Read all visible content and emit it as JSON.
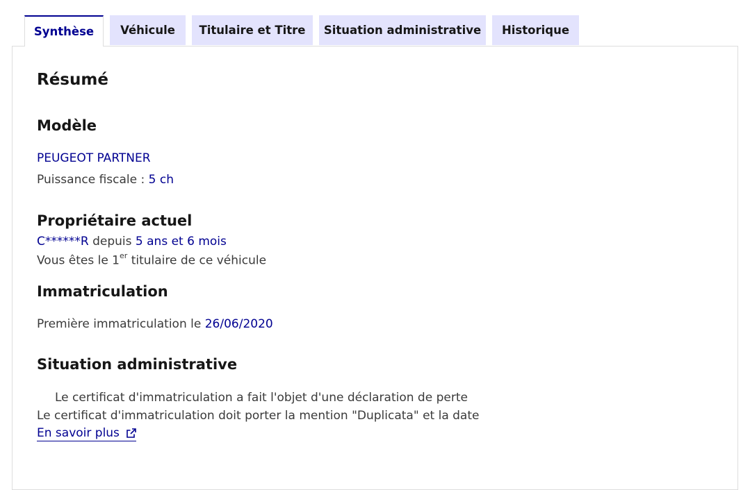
{
  "tabs": [
    {
      "label": "Synthèse",
      "active": true
    },
    {
      "label": "Véhicule"
    },
    {
      "label": "Titulaire et Titre"
    },
    {
      "label": "Situation administrative"
    },
    {
      "label": "Historique"
    }
  ],
  "summary": {
    "title": "Résumé",
    "model": {
      "heading": "Modèle",
      "name": "PEUGEOT PARTNER",
      "power_label": "Puissance fiscale :",
      "power_value": "5 ch"
    },
    "owner": {
      "heading": "Propriétaire actuel",
      "name": "C******R",
      "since_label": "depuis",
      "duration": "5 ans et 6 mois",
      "holder_prefix": "Vous êtes le 1",
      "holder_sup": "er",
      "holder_suffix": "titulaire de ce véhicule"
    },
    "registration": {
      "heading": "Immatriculation",
      "label": "Première immatriculation le",
      "date": "26/06/2020"
    },
    "admin": {
      "heading": "Situation administrative",
      "line1": "Le certificat d'immatriculation a fait l'objet d'une déclaration de perte",
      "line2": "Le certificat d'immatriculation doit porter la mention \"Duplicata\" et la date",
      "link": "En savoir plus",
      "link_icon": "external-link-icon"
    }
  },
  "colors": {
    "accent": "#000091",
    "tab_bg": "#e3e3fd",
    "border": "#dddddd",
    "text": "#3a3a3a"
  }
}
